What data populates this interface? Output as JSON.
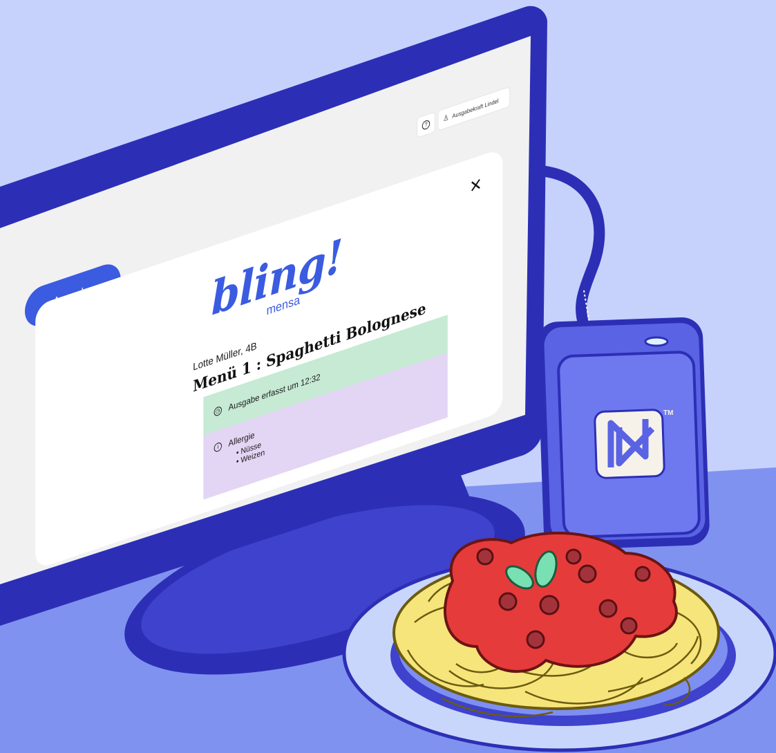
{
  "app": {
    "logo_text": "bling!",
    "logo_subtitle": "mensa"
  },
  "toolbar": {
    "help_icon": "question-circle-icon",
    "user_icon": "user-icon",
    "user_name": "Ausgabekraft Lindel"
  },
  "nav": {
    "ausgabe_label": "Ausgabe"
  },
  "dialog": {
    "close_label": "×",
    "student": "Lotte Müller, 4B",
    "menu": "Menü 1 : Spaghetti Bolognese",
    "success_icon": "check-circle-icon",
    "status": {
      "icon": "clock-icon",
      "text": "Ausgabe erfasst um 12:32"
    },
    "allergy": {
      "icon": "info-circle-icon",
      "title": "Allergie",
      "items": [
        "Nüsse",
        "Weizen"
      ]
    }
  },
  "nfc_reader": {
    "icon": "nfc-icon",
    "trademark": "TM"
  },
  "colors": {
    "background": "#c6d2fb",
    "table": "#8092f0",
    "monitor_frame": "#2c2fb5",
    "accent": "#3b5be0",
    "success": "#2f9a6c",
    "status_green": "#c6ead4",
    "allergy_purple": "#e3d5f4"
  }
}
